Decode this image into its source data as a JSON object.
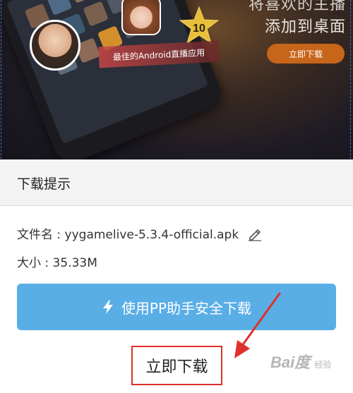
{
  "banner": {
    "promo_line_1": "将喜欢的主播",
    "promo_line_2": "添加到桌面",
    "download_label": "立即下载",
    "tagline": "最佳的Android直播应用",
    "star_number": "10"
  },
  "dialog": {
    "title": "下载提示",
    "filename_label": "文件名 : yygamelive-5.3.4-official.apk",
    "size_label": "大小 : 35.33M",
    "pp_button_label": "使用PP助手安全下载",
    "now_download_label": "立即下载"
  },
  "watermark": {
    "text": "Bai度",
    "sub": "经验"
  },
  "colors": {
    "pp_button": "#5aaee6",
    "highlight_box": "#e0302b",
    "promo_button": "#c7651a"
  },
  "icons": [
    "edit-pencil-icon",
    "lightning-bolt-icon",
    "star-icon",
    "arrow-icon"
  ]
}
